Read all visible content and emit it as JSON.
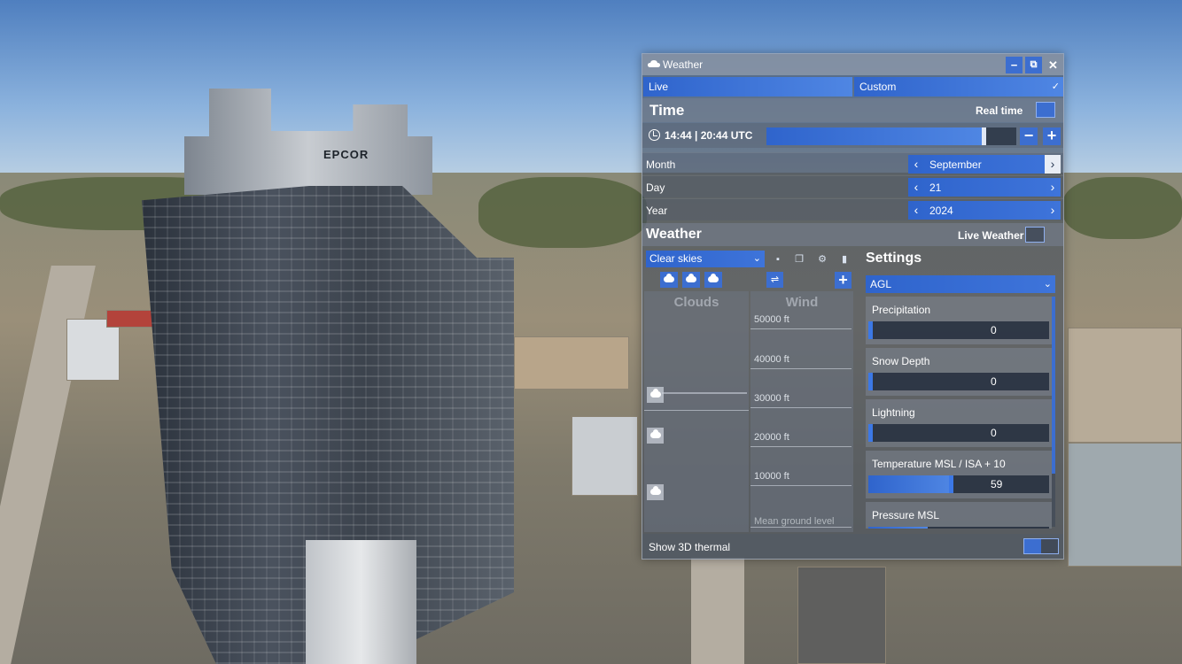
{
  "window": {
    "title": "Weather",
    "title_icon": "cloud-icon"
  },
  "controls": {
    "minimize": "−",
    "popout": "⧉",
    "close": "✕"
  },
  "tabs": [
    {
      "label": "Live"
    },
    {
      "label": "Custom",
      "check": "✓"
    }
  ],
  "time": {
    "section_title": "Time",
    "realtime_label": "Real time",
    "realtime_on": true,
    "display": "14:44 | 20:44 UTC",
    "slider_fraction": 0.86,
    "minus": "−",
    "plus": "+"
  },
  "date": {
    "month_label": "Month",
    "month_value": "September",
    "day_label": "Day",
    "day_value": "21",
    "year_label": "Year",
    "year_value": "2024",
    "prev": "‹",
    "next": "›"
  },
  "weather": {
    "section_title": "Weather",
    "live_label": "Live Weather",
    "live_on": false,
    "preset": "Clear skies",
    "preset_chevron": "⌄",
    "add": "+",
    "wind_icon": "⇌"
  },
  "columns": {
    "clouds_title": "Clouds",
    "wind_title": "Wind",
    "altitudes": [
      "50000 ft",
      "40000 ft",
      "30000 ft",
      "20000 ft",
      "10000 ft",
      "Mean ground level"
    ]
  },
  "settings": {
    "title": "Settings",
    "reference": "AGL",
    "reference_chevron": "⌄",
    "params": [
      {
        "label": "Precipitation",
        "value": "0",
        "fraction": 0.0
      },
      {
        "label": "Snow Depth",
        "value": "0",
        "fraction": 0.0
      },
      {
        "label": "Lightning",
        "value": "0",
        "fraction": 0.0
      },
      {
        "label": "Temperature MSL / ISA + 10",
        "value": "59",
        "fraction": 0.46
      },
      {
        "label": "Pressure MSL",
        "value": "",
        "fraction": 0.33
      }
    ]
  },
  "footer": {
    "thermal_label": "Show 3D thermal",
    "thermal_on": true
  },
  "colors": {
    "accent": "#3c6ed0",
    "panel": "#444e5c"
  },
  "scene": {
    "tower_sign": "EPCOR"
  }
}
